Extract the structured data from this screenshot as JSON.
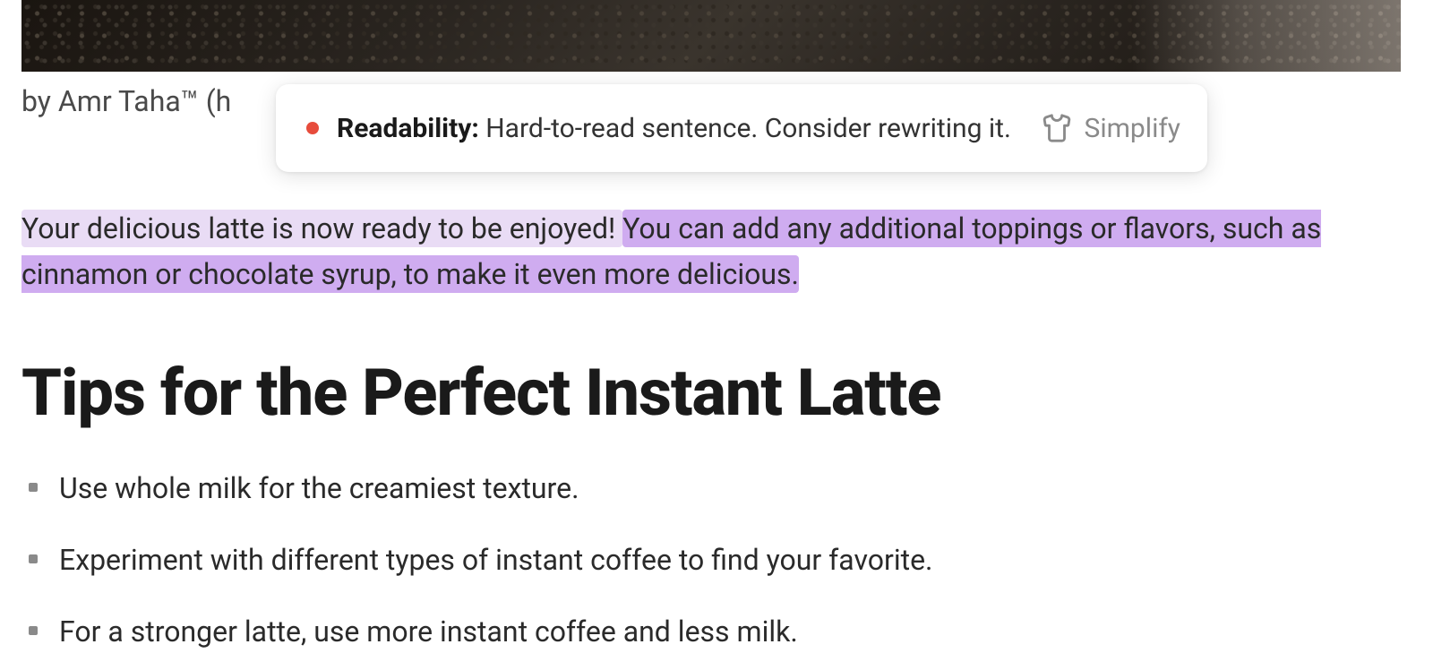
{
  "image": {
    "caption_prefix": "by Amr Taha™ (h"
  },
  "tooltip": {
    "category": "Readability:",
    "message": "Hard-to-read sentence. Consider rewriting it.",
    "action_label": "Simplify",
    "dot_color": "#e74c3c"
  },
  "paragraph": {
    "sentence_light": "Your delicious latte is now ready to be enjoyed! ",
    "sentence_dark": "You can add any additional toppings or flavors, such as cinnamon or chocolate syrup, to make it even more delicious."
  },
  "heading": "Tips for the Perfect Instant Latte",
  "tips": [
    "Use whole milk for the creamiest texture.",
    "Experiment with different types of instant coffee to find your favorite.",
    "For a stronger latte, use more instant coffee and less milk."
  ]
}
